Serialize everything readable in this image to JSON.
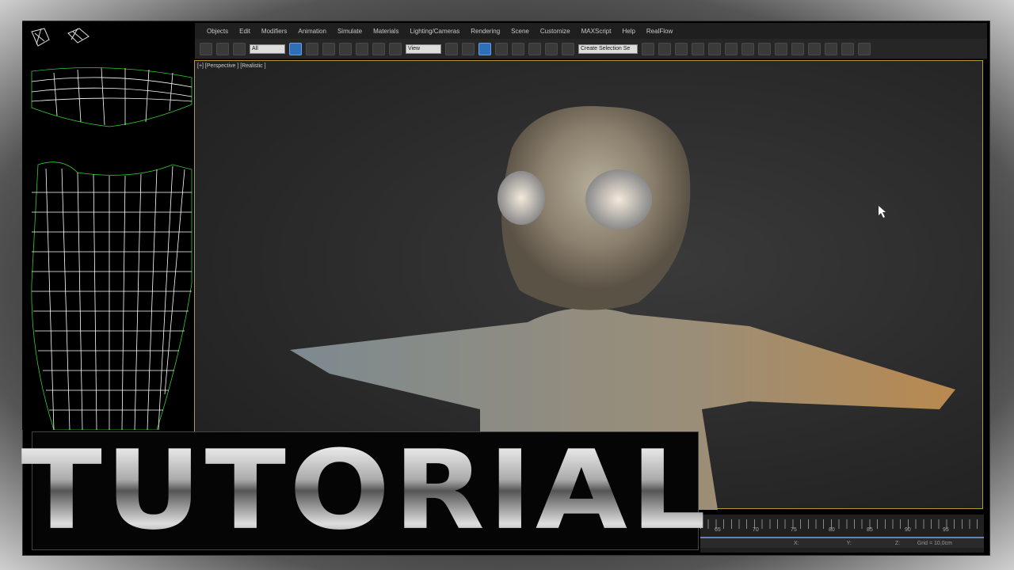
{
  "menu": [
    "Objects",
    "Edit",
    "Modifiers",
    "Animation",
    "Simulate",
    "Materials",
    "Lighting/Cameras",
    "Rendering",
    "Scene",
    "Customize",
    "MAXScript",
    "Help",
    "RealFlow"
  ],
  "toolbar": {
    "filter": "All",
    "coord": "View",
    "selection_set": "Create Selection Se"
  },
  "viewport": {
    "label": "[+] [Perspective ] [Realistic ]"
  },
  "timeline": {
    "ticks": [
      "65",
      "70",
      "75",
      "80",
      "85",
      "90",
      "95"
    ]
  },
  "status": {
    "x": "X:",
    "y": "Y:",
    "z": "Z:",
    "grid": "Grid = 10,0cm"
  },
  "overlay": {
    "title": "TUTORIAL"
  }
}
